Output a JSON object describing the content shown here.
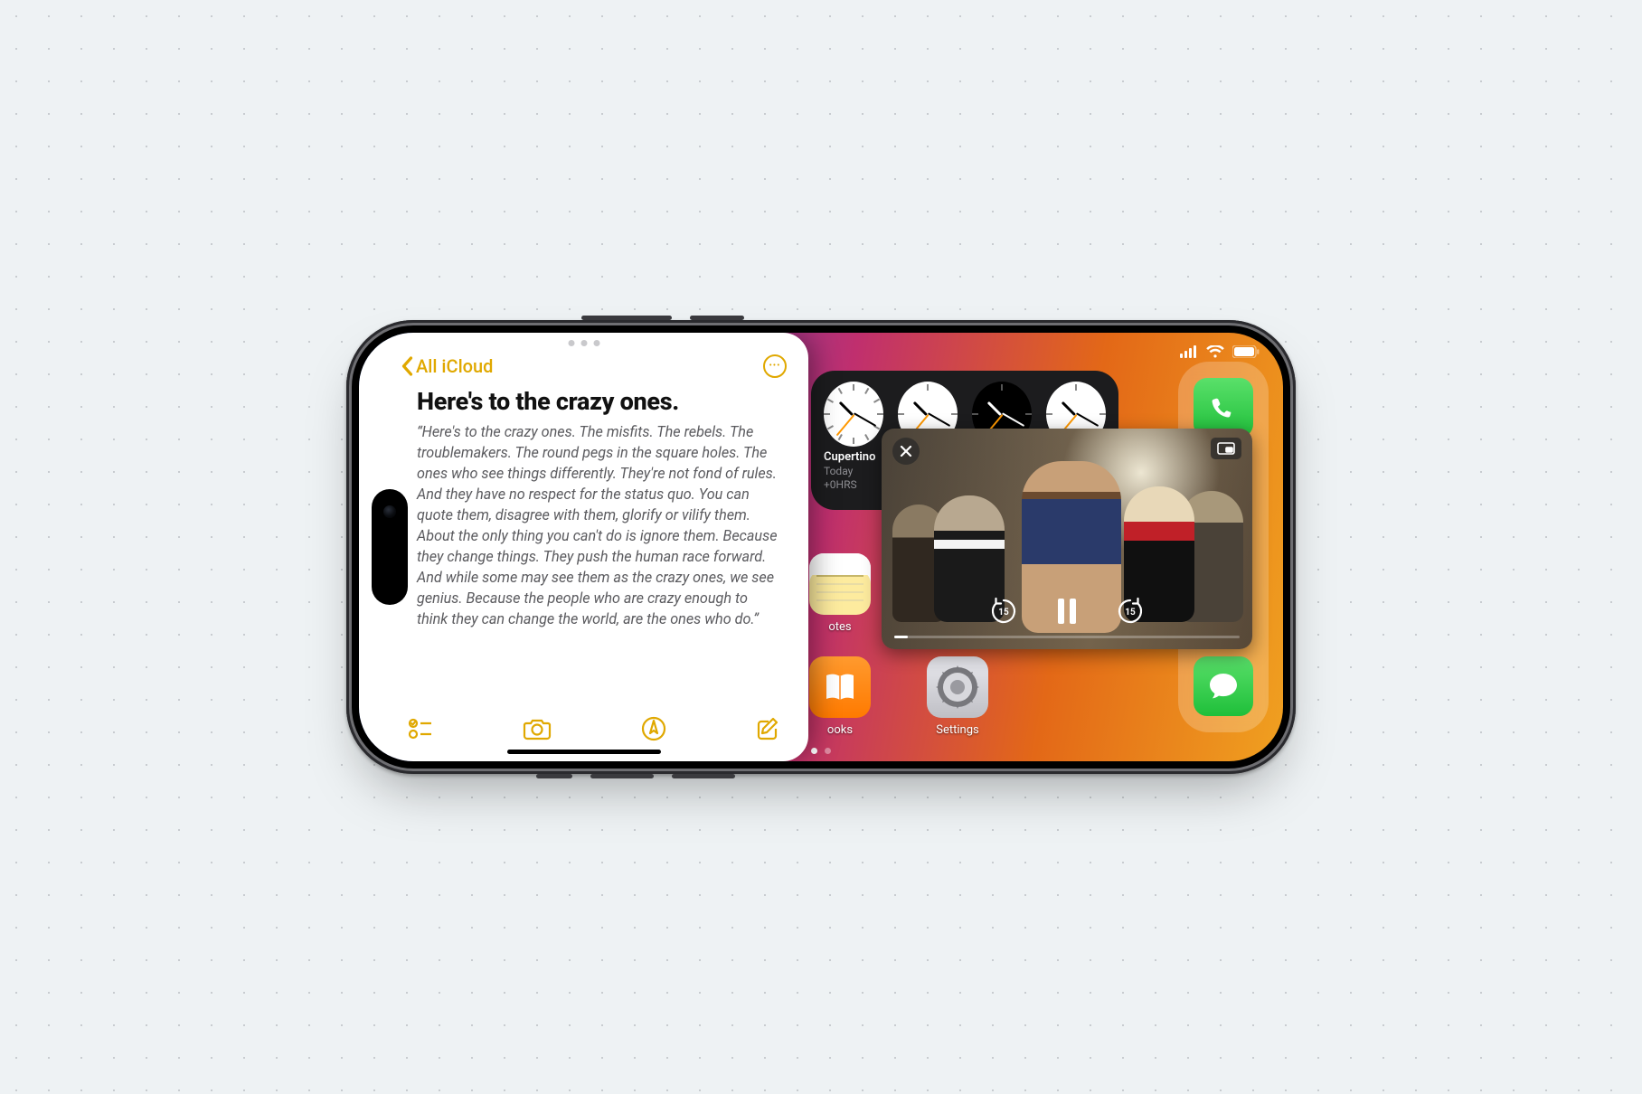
{
  "notes": {
    "back_label": "All iCloud",
    "title": "Here's to the crazy ones.",
    "body": "“Here's to the crazy ones. The misfits. The rebels. The troublemakers. The round pegs in the square holes. The ones who see things differently. They're not fond of rules. And they have no respect for the status quo. You can quote them, disagree with them, glorify or vilify them. About the only thing you can't do is ignore them. Because they change things. They push the human race forward. And while some may see them as the crazy ones, we see genius. Because the people who are crazy enough to think they can change the world, are the ones who do.”"
  },
  "clock_widget": {
    "city": "Cupertino",
    "day": "Today",
    "offset": "+0HRS"
  },
  "home": {
    "notes_label": "otes",
    "books_label": "ooks",
    "settings_label": "Settings"
  },
  "pip": {
    "skip_back": "15",
    "skip_fwd": "15"
  },
  "colors": {
    "notes_accent": "#e0a800",
    "phone_green": "#34c759",
    "messages_green": "#30d158"
  }
}
